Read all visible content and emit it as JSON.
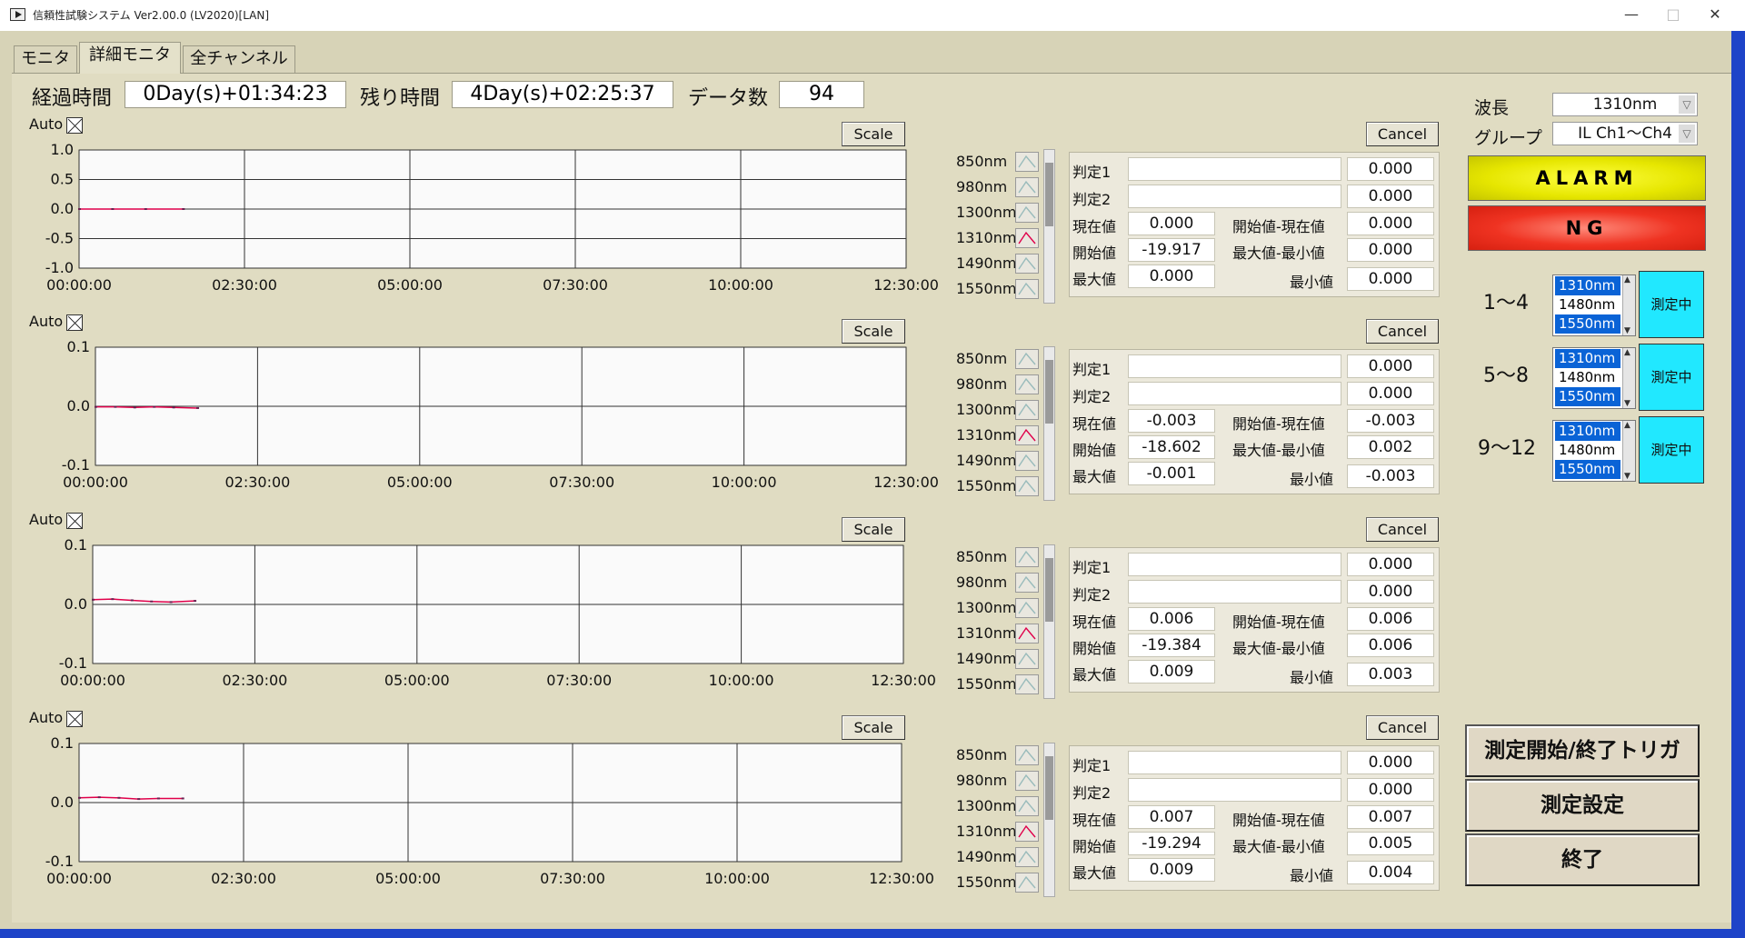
{
  "window": {
    "title": "信頼性試験システム Ver2.00.0  (LV2020)[LAN]",
    "minimize": "—",
    "maximize": "□",
    "close": "✕"
  },
  "tabs": [
    "モニタ",
    "詳細モニタ",
    "全チャンネル"
  ],
  "header": {
    "elapsed_label": "経過時間",
    "elapsed_value": "0Day(s)+01:34:23",
    "remaining_label": "残り時間",
    "remaining_value": "4Day(s)+02:25:37",
    "count_label": "データ数",
    "count_value": "94"
  },
  "auto_label": "Auto",
  "scale_label": "Scale",
  "cancel_label": "Cancel",
  "wavelength_list": [
    "850nm",
    "980nm",
    "1300nm",
    "1310nm",
    "1490nm",
    "1550nm"
  ],
  "panel_labels": {
    "j1": "判定1",
    "j2": "判定2",
    "cur": "現在値",
    "start": "開始値",
    "max": "最大値",
    "start_minus_cur": "開始値-現在値",
    "max_minus_min": "最大値-最小値",
    "min": "最小値"
  },
  "panels": [
    {
      "j1": "",
      "j1v": "0.000",
      "j2": "",
      "j2v": "0.000",
      "cur": "0.000",
      "start": "-19.917",
      "max": "0.000",
      "start_minus_cur": "0.000",
      "max_minus_min": "0.000",
      "min": "0.000"
    },
    {
      "j1": "",
      "j1v": "0.000",
      "j2": "",
      "j2v": "0.000",
      "cur": "-0.003",
      "start": "-18.602",
      "max": "-0.001",
      "start_minus_cur": "-0.003",
      "max_minus_min": "0.002",
      "min": "-0.003"
    },
    {
      "j1": "",
      "j1v": "0.000",
      "j2": "",
      "j2v": "0.000",
      "cur": "0.006",
      "start": "-19.384",
      "max": "0.009",
      "start_minus_cur": "0.006",
      "max_minus_min": "0.006",
      "min": "0.003"
    },
    {
      "j1": "",
      "j1v": "0.000",
      "j2": "",
      "j2v": "0.000",
      "cur": "0.007",
      "start": "-19.294",
      "max": "0.009",
      "start_minus_cur": "0.007",
      "max_minus_min": "0.005",
      "min": "0.004"
    }
  ],
  "right": {
    "wavelength_label": "波長",
    "wavelength_value": "1310nm",
    "group_label": "グループ",
    "group_value": "IL Ch1～Ch4",
    "alarm": "ALARM",
    "ng": "NG",
    "groups": [
      {
        "label": "1～4",
        "items": [
          "1310nm",
          "1480nm",
          "1550nm"
        ],
        "status": "測定中"
      },
      {
        "label": "5～8",
        "items": [
          "1310nm",
          "1480nm",
          "1550nm"
        ],
        "status": "測定中"
      },
      {
        "label": "9～12",
        "items": [
          "1310nm",
          "1480nm",
          "1550nm"
        ],
        "status": "測定中"
      }
    ],
    "trigger_button": "測定開始/終了トリガ",
    "settings_button": "測定設定",
    "exit_button": "終了"
  },
  "colors": {
    "trace_red": "#e0004a",
    "trace_dark": "#6a2050",
    "alarm_yellow": "#e6e600",
    "ng_red": "#ef3322",
    "measuring_cyan": "#21e8ff"
  },
  "chart_data": [
    {
      "type": "line",
      "x_ticks": [
        "00:00:00",
        "02:30:00",
        "05:00:00",
        "07:30:00",
        "10:00:00",
        "12:30:00"
      ],
      "y_ticks": [
        "1.0",
        "0.5",
        "0.0",
        "-0.5",
        "-1.0"
      ],
      "ylim": [
        -1.0,
        1.0
      ],
      "xlim_hours": [
        0,
        12.5
      ],
      "series": [
        {
          "x_hours": [
            0,
            0.5,
            1.0,
            1.57
          ],
          "y": [
            0.0,
            0.0,
            0.0,
            0.0
          ]
        }
      ]
    },
    {
      "type": "line",
      "x_ticks": [
        "00:00:00",
        "02:30:00",
        "05:00:00",
        "07:30:00",
        "10:00:00",
        "12:30:00"
      ],
      "y_ticks": [
        "0.1",
        "0.0",
        "-0.1"
      ],
      "ylim": [
        -0.1,
        0.1
      ],
      "xlim_hours": [
        0,
        12.5
      ],
      "series": [
        {
          "x_hours": [
            0,
            0.3,
            0.6,
            0.9,
            1.2,
            1.57
          ],
          "y": [
            -0.001,
            -0.001,
            -0.002,
            -0.001,
            -0.002,
            -0.003
          ]
        }
      ]
    },
    {
      "type": "line",
      "x_ticks": [
        "00:00:00",
        "02:30:00",
        "05:00:00",
        "07:30:00",
        "10:00:00",
        "12:30:00"
      ],
      "y_ticks": [
        "0.1",
        "0.0",
        "-0.1"
      ],
      "ylim": [
        -0.1,
        0.1
      ],
      "xlim_hours": [
        0,
        12.5
      ],
      "series": [
        {
          "x_hours": [
            0,
            0.3,
            0.6,
            0.9,
            1.2,
            1.57
          ],
          "y": [
            0.008,
            0.009,
            0.007,
            0.005,
            0.004,
            0.006
          ]
        }
      ]
    },
    {
      "type": "line",
      "x_ticks": [
        "00:00:00",
        "02:30:00",
        "05:00:00",
        "07:30:00",
        "10:00:00",
        "12:30:00"
      ],
      "y_ticks": [
        "0.1",
        "0.0",
        "-0.1"
      ],
      "ylim": [
        -0.1,
        0.1
      ],
      "xlim_hours": [
        0,
        12.5
      ],
      "series": [
        {
          "x_hours": [
            0,
            0.3,
            0.6,
            0.9,
            1.2,
            1.57
          ],
          "y": [
            0.008,
            0.009,
            0.008,
            0.006,
            0.007,
            0.007
          ]
        }
      ]
    }
  ]
}
